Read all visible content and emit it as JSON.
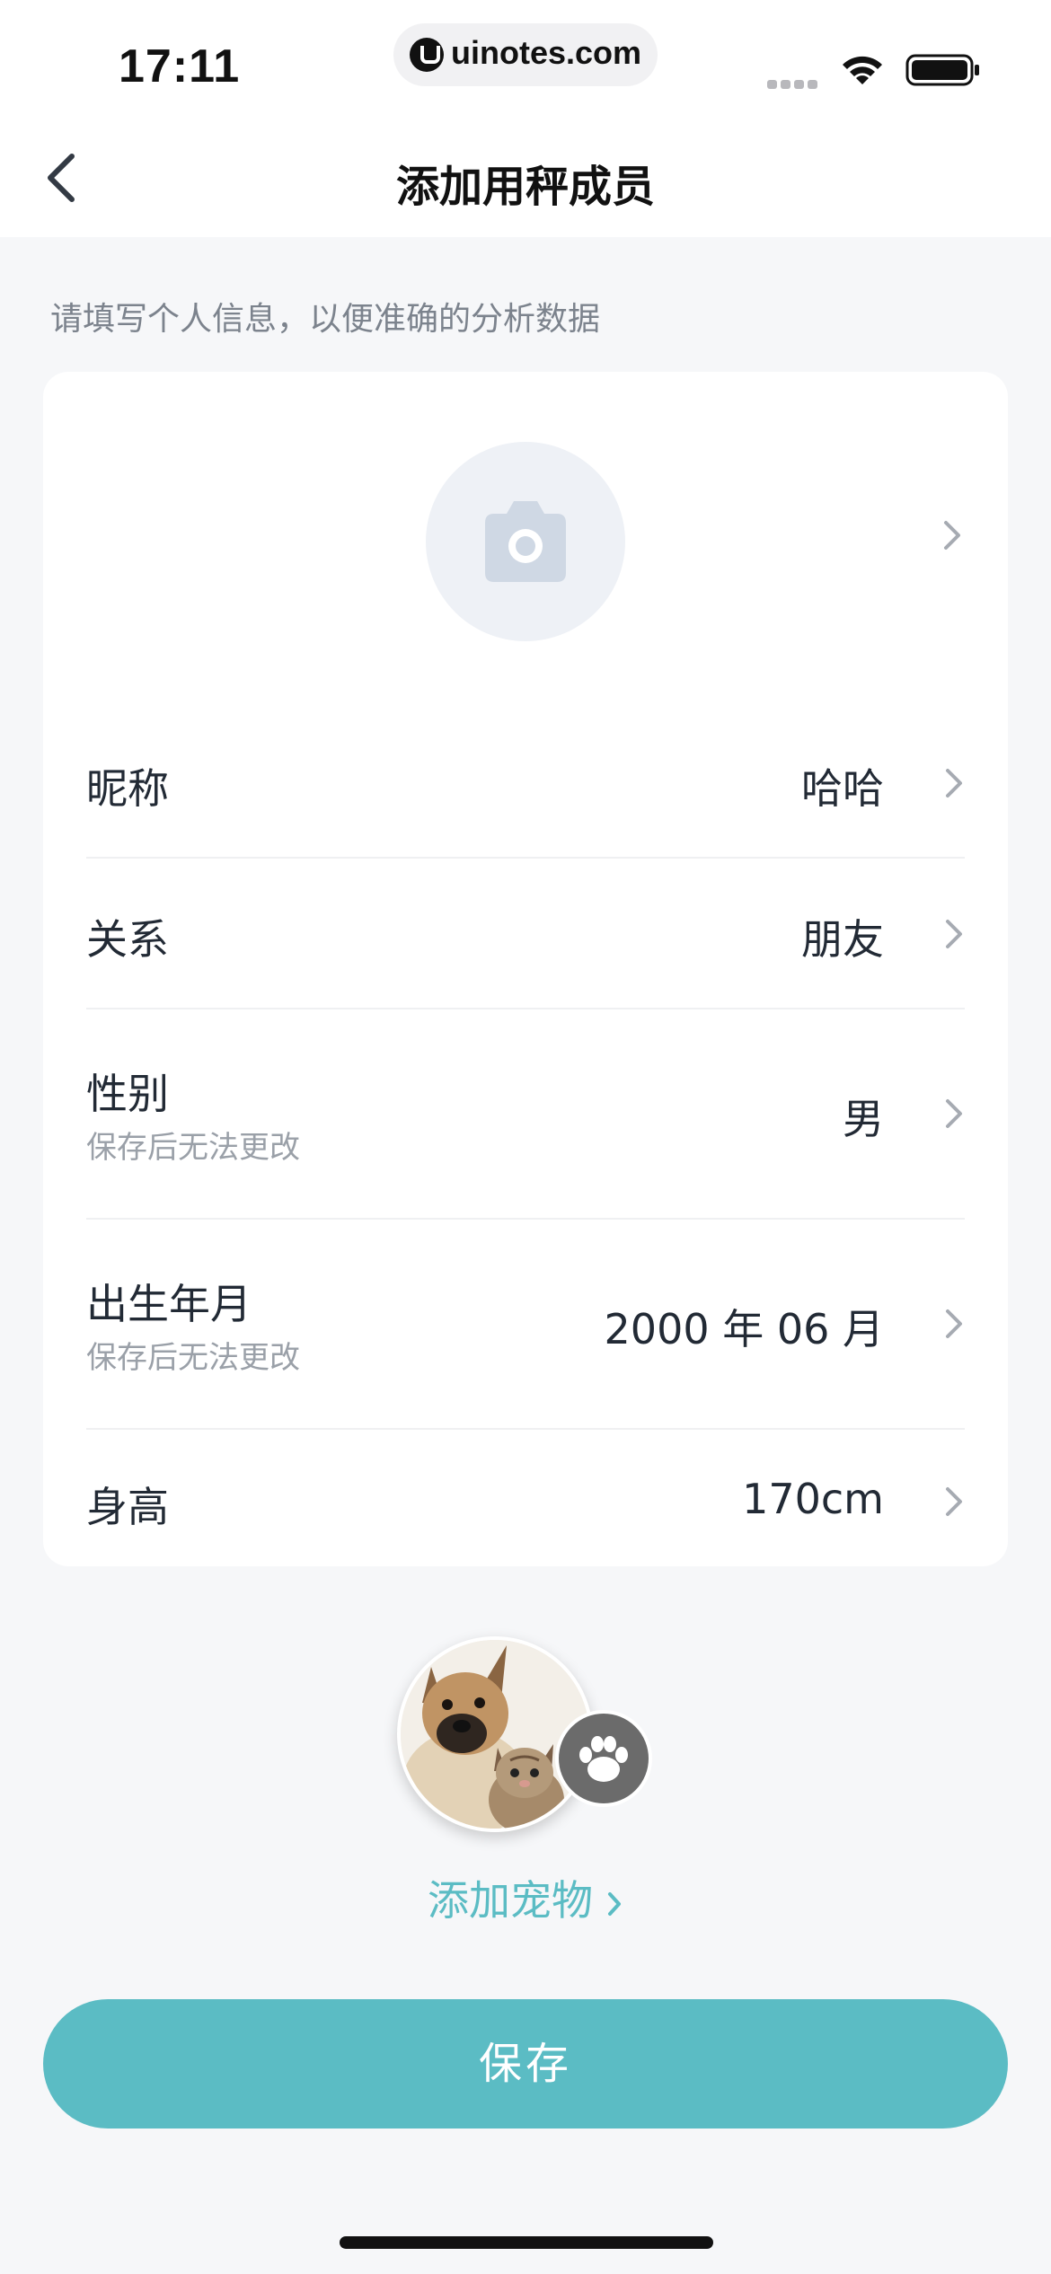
{
  "status_bar": {
    "time": "17:11",
    "url": "uinotes.com"
  },
  "nav": {
    "title": "添加用秤成员"
  },
  "hint": "请填写个人信息，以便准确的分析数据",
  "form": {
    "rows": [
      {
        "label": "昵称",
        "sub": "",
        "value": "哈哈"
      },
      {
        "label": "关系",
        "sub": "",
        "value": "朋友"
      },
      {
        "label": "性别",
        "sub": "保存后无法更改",
        "value": "男"
      },
      {
        "label": "出生年月",
        "sub": "保存后无法更改",
        "value": "2000 年 06 月"
      },
      {
        "label": "身高",
        "sub": "",
        "value": "170cm"
      }
    ]
  },
  "pet": {
    "add_label": "添加宠物"
  },
  "save_label": "保存",
  "colors": {
    "accent": "#5bbcc4",
    "background": "#f6f7f9",
    "card": "#ffffff"
  },
  "icons": {
    "back": "chevron-left-icon",
    "camera": "camera-icon",
    "row_arrow": "chevron-right-icon",
    "paw": "paw-icon"
  }
}
